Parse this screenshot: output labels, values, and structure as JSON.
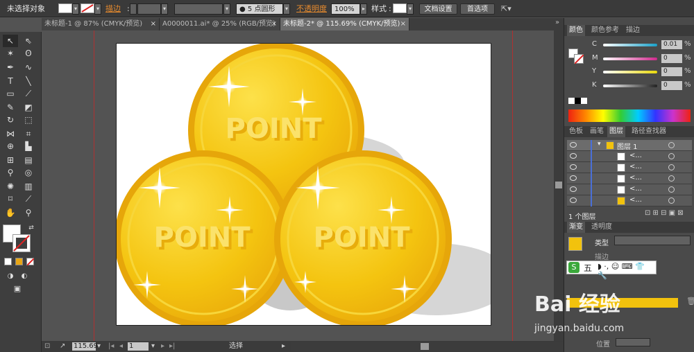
{
  "control_bar": {
    "selection_status": "未选择对象",
    "stroke_label": "描边",
    "brush_label": "5 点圆形",
    "opacity_label": "不透明度",
    "opacity_value": "100%",
    "style_label": "样式",
    "doc_settings": "文档设置",
    "preferences": "首选项"
  },
  "tabs": [
    {
      "label": "未标题-1 @ 87% (CMYK/预览)"
    },
    {
      "label": "A0000011.ai* @ 25% (RGB/预览)"
    },
    {
      "label": "未标题-2* @ 115.69% (CMYK/预览)"
    }
  ],
  "tab_close": "×",
  "canvas": {
    "coin_text": "POINT",
    "coin_color": "#f2c20d",
    "coin_rim": "#e6a60a",
    "shadow": "#cfcfcf"
  },
  "status": {
    "zoom": "115.69",
    "page": "1",
    "tool": "选择"
  },
  "color_panel": {
    "tabs": [
      "颜色",
      "颜色参考",
      "描边"
    ],
    "channels": [
      {
        "label": "C",
        "value": "0.01",
        "pct": "%",
        "color": "#1aa0c8"
      },
      {
        "label": "M",
        "value": "0",
        "pct": "%",
        "color": "#d0288c"
      },
      {
        "label": "Y",
        "value": "0",
        "pct": "%",
        "color": "#e8d80c"
      },
      {
        "label": "K",
        "value": "0",
        "pct": "%",
        "color": "#333333"
      }
    ]
  },
  "layers_panel": {
    "tabs": [
      "色板",
      "画笔",
      "图层",
      "路径查找器"
    ],
    "rows": [
      {
        "name": "图层 1"
      },
      {
        "name": "<..."
      },
      {
        "name": "<..."
      },
      {
        "name": "<..."
      },
      {
        "name": "<..."
      },
      {
        "name": "<..."
      }
    ],
    "count": "1 个图层"
  },
  "gradient_panel": {
    "tabs": [
      "渐变",
      "透明度"
    ],
    "type_label": "类型",
    "stroke_label": "描边",
    "position_label": "位置"
  },
  "ime": {
    "label": "五"
  },
  "watermark": {
    "main": "Bai 经验",
    "sub": "jingyan.baidu.com"
  }
}
